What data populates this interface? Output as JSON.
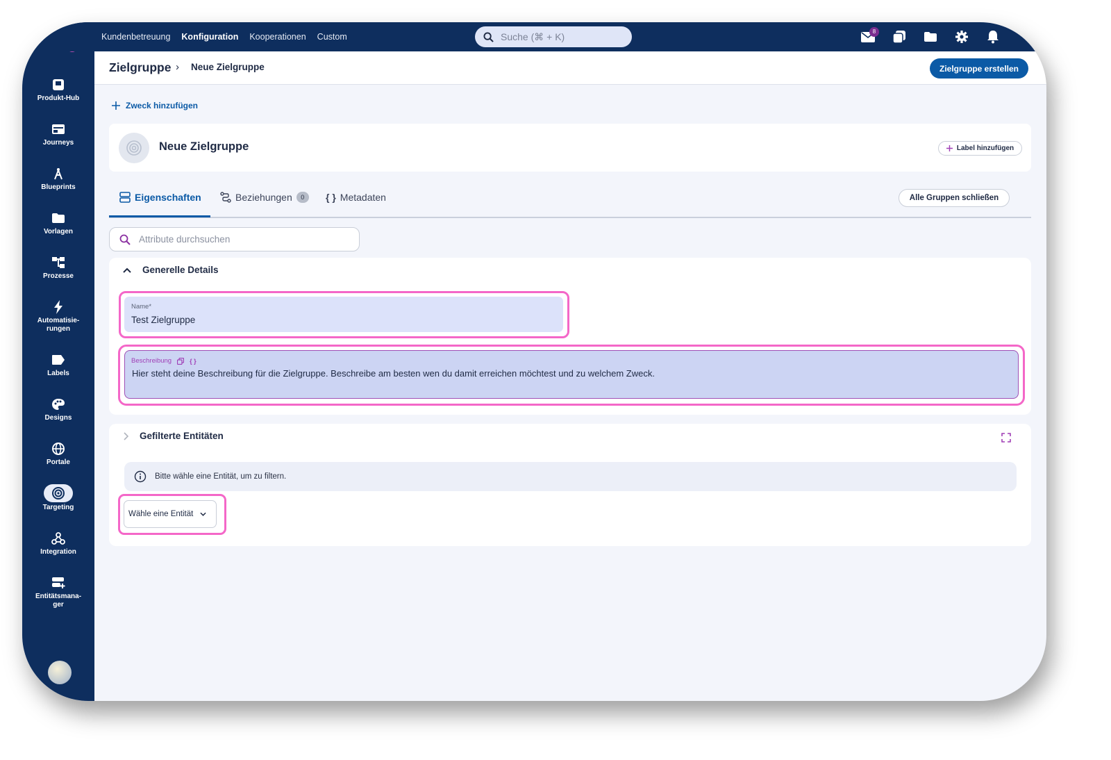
{
  "topbar": {
    "nav": [
      "Kundenbetreuung",
      "Konfiguration",
      "Kooperationen",
      "Custom"
    ],
    "active_nav": "Konfiguration",
    "search_placeholder": "Suche (⌘ + K)",
    "mail_badge": "8"
  },
  "sidebar": {
    "items": [
      {
        "label": "Produkt-Hub",
        "icon": "product-hub-icon"
      },
      {
        "label": "Journeys",
        "icon": "journeys-icon"
      },
      {
        "label": "Blueprints",
        "icon": "compass-icon"
      },
      {
        "label": "Vorlagen",
        "icon": "folder-icon"
      },
      {
        "label": "Prozesse",
        "icon": "process-icon"
      },
      {
        "label": "Automatisie-\nrungen",
        "icon": "lightning-icon"
      },
      {
        "label": "Labels",
        "icon": "label-icon"
      },
      {
        "label": "Designs",
        "icon": "palette-icon"
      },
      {
        "label": "Portale",
        "icon": "globe-icon"
      },
      {
        "label": "Targeting",
        "icon": "target-icon",
        "active": true
      },
      {
        "label": "Integration",
        "icon": "webhook-icon"
      },
      {
        "label": "Entitätsmana-\nger",
        "icon": "entity-manager-icon"
      }
    ]
  },
  "header": {
    "breadcrumb_root": "Zielgruppe",
    "breadcrumb_current": "Neue Zielgruppe",
    "create_button": "Zielgruppe erstellen"
  },
  "purpose": {
    "add_label": "Zweck hinzufügen"
  },
  "entity_card": {
    "title": "Neue Zielgruppe",
    "add_label_button": "Label hinzufügen"
  },
  "tabs": {
    "items": [
      "Eigenschaften",
      "Beziehungen",
      "Metadaten"
    ],
    "relations_count": "0",
    "close_groups_button": "Alle Gruppen schließen"
  },
  "attribute_search": {
    "placeholder": "Attribute durchsuchen"
  },
  "general": {
    "title": "Generelle Details",
    "name_label": "Name*",
    "name_value": "Test Zielgruppe",
    "description_label": "Beschreibung",
    "description_value": "Hier steht deine Beschreibung für die Zielgruppe. Beschreibe am besten wen du damit erreichen möchtest und zu welchem Zweck."
  },
  "filtered": {
    "title": "Gefilterte Entitäten",
    "info": "Bitte wähle eine Entität, um zu filtern.",
    "select_label": "Wähle eine Entität"
  },
  "colors": {
    "navy": "#0e2e5e",
    "primary_blue": "#0b5aa6",
    "highlight_pink": "#f467c8",
    "badge_purple": "#7a2d8f"
  }
}
